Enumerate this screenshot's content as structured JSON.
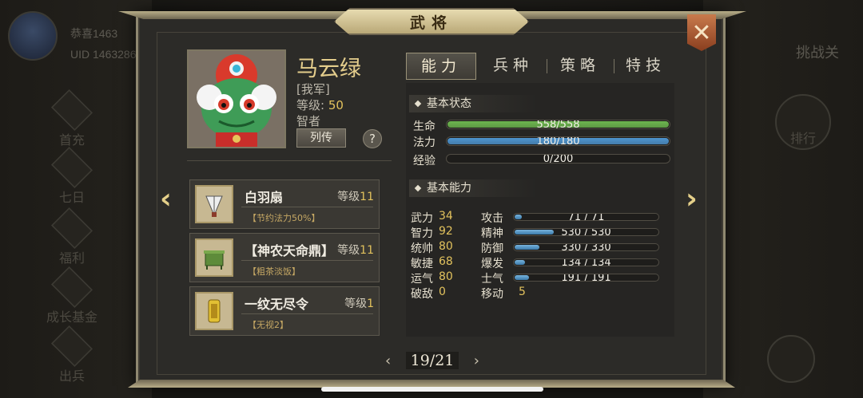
{
  "background": {
    "player_name": "恭喜1463",
    "uid": "UID 1463286",
    "left_menu": [
      "首充",
      "七日",
      "福利",
      "成长基金",
      "出兵"
    ],
    "right_menu": [
      "挑战关",
      "排行"
    ]
  },
  "dialog": {
    "title": "武将",
    "close_icon": "close-x-icon"
  },
  "hero": {
    "name": "马云绿",
    "camp": "[我军]",
    "level_label": "等级:",
    "level_value": "50",
    "role": "智者",
    "bio_button": "列传",
    "help_button": "?"
  },
  "equipment": [
    {
      "name": "白羽扇",
      "level_label": "等级",
      "level": "11",
      "skill": "【节约法力50%】",
      "icon": "feather-fan-icon"
    },
    {
      "name": "【神农天命鼎】",
      "level_label": "等级",
      "level": "11",
      "skill": "【粗茶淡饭】",
      "icon": "cauldron-icon"
    },
    {
      "name": "一纹无尽令",
      "level_label": "等级",
      "level": "1",
      "skill": "【无视2】",
      "icon": "token-icon"
    }
  ],
  "tabs": [
    "能力",
    "兵种",
    "策略",
    "特技"
  ],
  "active_tab": 0,
  "basic_status": {
    "title": "基本状态",
    "bars": [
      {
        "label": "生命",
        "text": "558/558",
        "fraction": 1.0,
        "color": "#6db64f"
      },
      {
        "label": "法力",
        "text": "180/180",
        "fraction": 1.0,
        "color": "#4e94cf"
      },
      {
        "label": "经验",
        "text": "0/200",
        "fraction": 0.0,
        "color": "#e2c25d"
      }
    ]
  },
  "basic_ability": {
    "title": "基本能力",
    "attributes": [
      {
        "name": "武力",
        "value": "34"
      },
      {
        "name": "智力",
        "value": "92"
      },
      {
        "name": "统帅",
        "value": "80"
      },
      {
        "name": "敏捷",
        "value": "68"
      },
      {
        "name": "运气",
        "value": "80"
      },
      {
        "name": "破敌",
        "value": "0"
      }
    ],
    "combat": [
      {
        "name": "攻击",
        "text": "71 / 71",
        "fraction": 0.05
      },
      {
        "name": "精神",
        "text": "530 / 530",
        "fraction": 0.27
      },
      {
        "name": "防御",
        "text": "330 / 330",
        "fraction": 0.17
      },
      {
        "name": "爆发",
        "text": "134 / 134",
        "fraction": 0.07
      },
      {
        "name": "士气",
        "text": "191 / 191",
        "fraction": 0.1
      }
    ],
    "move_label": "移动",
    "move_value": "5"
  },
  "pager": {
    "prev": "‹",
    "current": "19/21",
    "next": "›"
  },
  "nav": {
    "left_arrow": "‹",
    "right_arrow": "›"
  }
}
